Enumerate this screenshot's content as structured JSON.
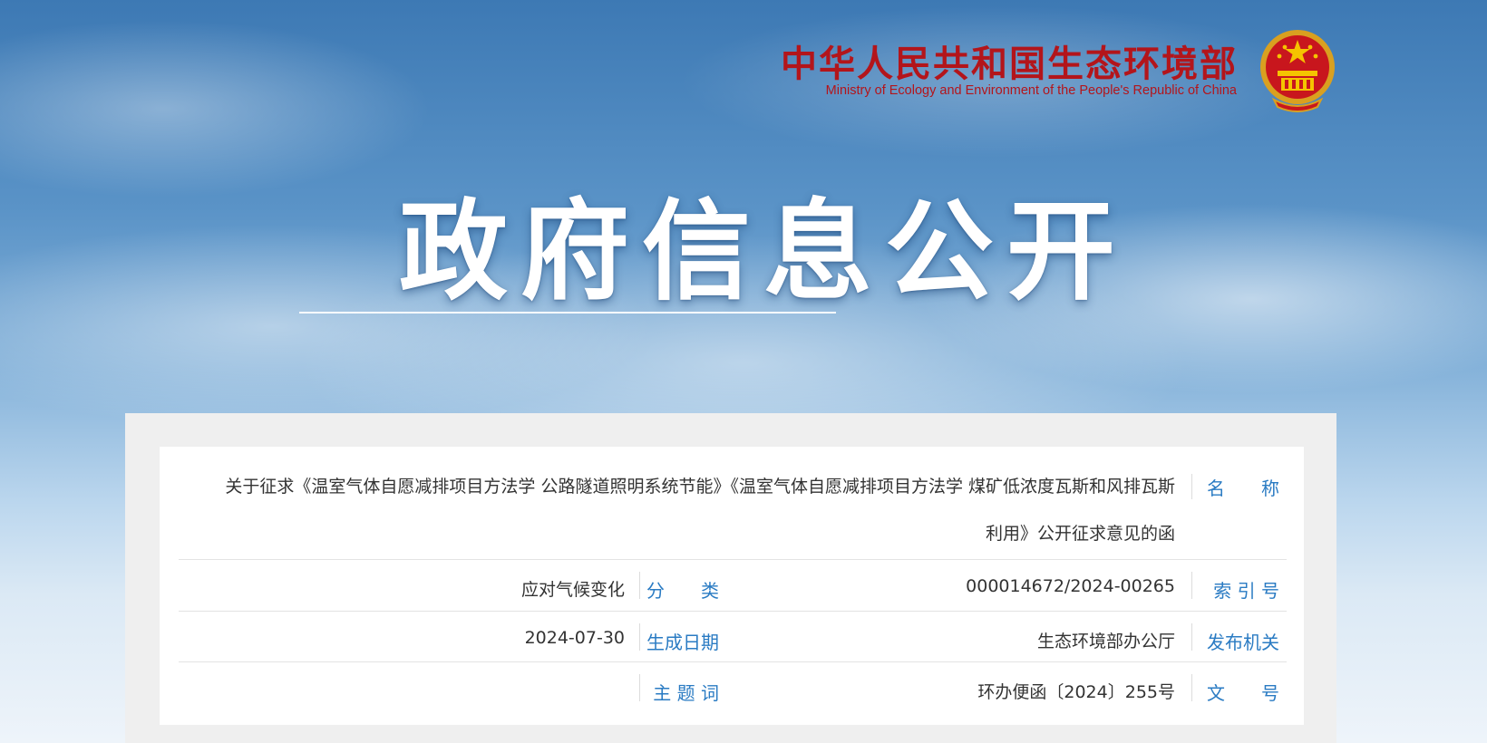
{
  "header": {
    "ministry_cn": "中华人民共和国生态环境部",
    "ministry_en": "Ministry of Ecology and Environment of the People's Republic of China",
    "emblem_icon": "national-emblem-icon"
  },
  "banner": {
    "title": "政府信息公开"
  },
  "info": {
    "name_label": "名　　称",
    "name_value": "关于征求《温室气体自愿减排项目方法学 公路隧道照明系统节能》《温室气体自愿减排项目方法学 煤矿低浓度瓦斯和风排瓦斯利用》公开征求意见的函",
    "index_label": "索 引 号",
    "index_value": "000014672/2024-00265",
    "category_label": "分　　类",
    "category_value": "应对气候变化",
    "issuer_label": "发布机关",
    "issuer_value": "生态环境部办公厅",
    "date_label": "生成日期",
    "date_value": "2024-07-30",
    "docno_label": "文　　号",
    "docno_value": "环办便函〔2024〕255号",
    "subject_label": "主 题 词",
    "subject_value": ""
  },
  "colors": {
    "label_blue": "#2a7bc3",
    "ministry_red": "#b3151b",
    "text_dark": "#333333"
  }
}
